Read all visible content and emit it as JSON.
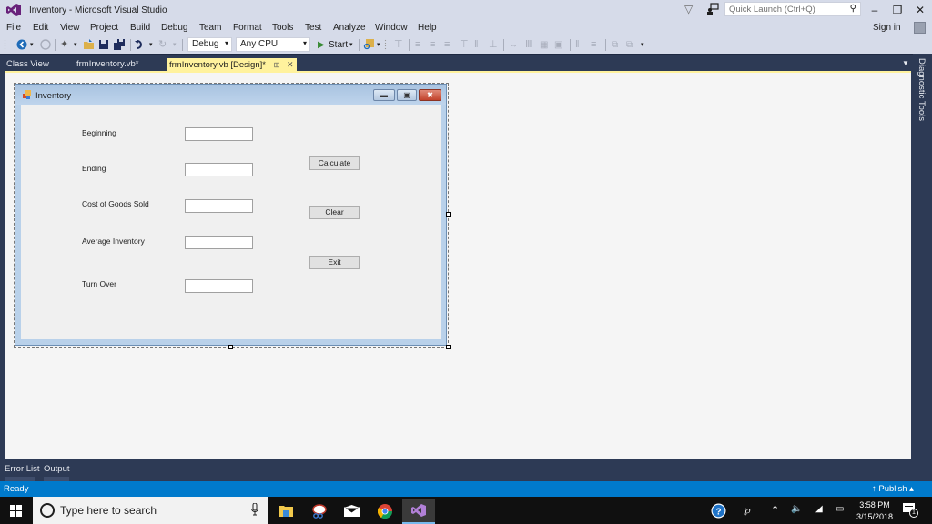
{
  "window": {
    "title": "Inventory - Microsoft Visual Studio",
    "quick_launch_placeholder": "Quick Launch (Ctrl+Q)",
    "minimize_glyph": "–",
    "restore_glyph": "❐",
    "close_glyph": "✕"
  },
  "menu": {
    "items": [
      "File",
      "Edit",
      "View",
      "Project",
      "Build",
      "Debug",
      "Team",
      "Format",
      "Tools",
      "Test",
      "Analyze",
      "Window",
      "Help"
    ],
    "sign_in": "Sign in"
  },
  "toolbar": {
    "configuration": "Debug",
    "platform": "Any CPU",
    "start_label": "Start"
  },
  "tabs": {
    "items": [
      {
        "label": "Class View",
        "active": false
      },
      {
        "label": "frmInventory.vb*",
        "active": false
      },
      {
        "label": "frmInventory.vb [Design]*",
        "active": true
      }
    ],
    "pin_glyph": "⊞",
    "close_glyph": "✕"
  },
  "form": {
    "title": "Inventory",
    "labels": [
      "Beginning",
      "Ending",
      "Cost of Goods Sold",
      "Average Inventory",
      "Turn Over"
    ],
    "textbox_values": [
      "",
      "",
      "",
      "",
      ""
    ],
    "buttons": [
      "Calculate",
      "Clear",
      "Exit"
    ]
  },
  "side_panel": {
    "diagnostic_tools": "Diagnostic Tools"
  },
  "bottom_tabs": [
    "Error List",
    "Output"
  ],
  "status": {
    "text": "Ready",
    "publish": "↑  Publish ▴"
  },
  "taskbar": {
    "search_placeholder": "Type here to search",
    "time": "3:58 PM",
    "date": "3/15/2018",
    "notification_count": "1"
  }
}
